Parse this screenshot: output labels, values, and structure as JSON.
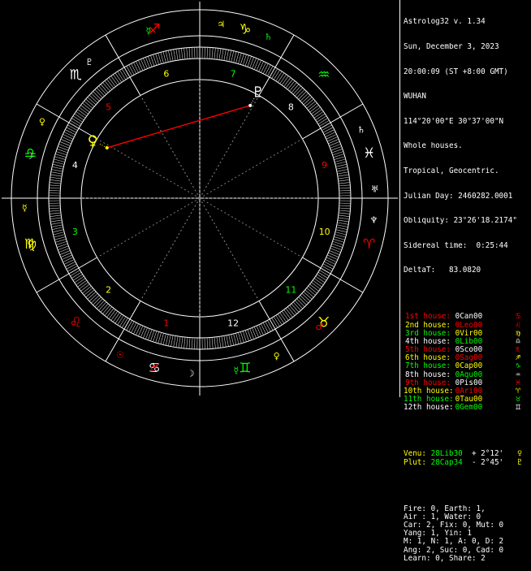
{
  "info": {
    "program": "Astrolog32 v. 1.34",
    "date": "Sun, December 3, 2023",
    "time": "20:00:09 (ST +8:00 GMT)",
    "place": "WUHAN",
    "coords": "114°20'00\"E 30°37'00\"N",
    "house_system": "Whole houses.",
    "zodiac": "Tropical, Geocentric.",
    "julian_day": "Julian Day: 2460282.0001",
    "obliquity": "Obliquity: 23°26'18.2174\"",
    "sidereal_time": "Sidereal time:  0:25:44",
    "delta_t": "DeltaT:   83.0820"
  },
  "houses": [
    {
      "name": "1st house:",
      "cusp": "0Can00",
      "glyph": "♋",
      "name_color": "#ff0000",
      "cusp_color": "#ffffff",
      "glyph_color": "#ff0000"
    },
    {
      "name": "2nd house:",
      "cusp": "0Leo00",
      "glyph": "♌",
      "name_color": "#ffff00",
      "cusp_color": "#ff0000",
      "glyph_color": "#ff0000"
    },
    {
      "name": "3rd house:",
      "cusp": "0Vir00",
      "glyph": "♍",
      "name_color": "#00ff00",
      "cusp_color": "#ffff00",
      "glyph_color": "#ffff00"
    },
    {
      "name": "4th house:",
      "cusp": "0Lib00",
      "glyph": "♎",
      "name_color": "#ffffff",
      "cusp_color": "#00ff00",
      "glyph_color": "#ffffff"
    },
    {
      "name": "5th house:",
      "cusp": "0Sco00",
      "glyph": "♏",
      "name_color": "#ff0000",
      "cusp_color": "#ffffff",
      "glyph_color": "#ff0000"
    },
    {
      "name": "6th house:",
      "cusp": "0Sag00",
      "glyph": "♐",
      "name_color": "#ffff00",
      "cusp_color": "#ff0000",
      "glyph_color": "#ffff00"
    },
    {
      "name": "7th house:",
      "cusp": "0Cap00",
      "glyph": "♑",
      "name_color": "#00ff00",
      "cusp_color": "#ffff00",
      "glyph_color": "#00ff00"
    },
    {
      "name": "8th house:",
      "cusp": "0Aqu00",
      "glyph": "♒",
      "name_color": "#ffffff",
      "cusp_color": "#00ff00",
      "glyph_color": "#ffffff"
    },
    {
      "name": "9th house:",
      "cusp": "0Pis00",
      "glyph": "♓",
      "name_color": "#ff0000",
      "cusp_color": "#ffffff",
      "glyph_color": "#ff0000"
    },
    {
      "name": "10th house:",
      "cusp": "0Ari00",
      "glyph": "♈",
      "name_color": "#ffff00",
      "cusp_color": "#ff0000",
      "glyph_color": "#ffff00"
    },
    {
      "name": "11th house:",
      "cusp": "0Tau00",
      "glyph": "♉",
      "name_color": "#00ff00",
      "cusp_color": "#ffff00",
      "glyph_color": "#00ff00"
    },
    {
      "name": "12th house:",
      "cusp": "0Gem00",
      "glyph": "♊",
      "name_color": "#ffffff",
      "cusp_color": "#00ff00",
      "glyph_color": "#ffffff"
    }
  ],
  "aspects": [
    {
      "planet": "Venu:",
      "pos": "28Lib30",
      "orb": "+ 2°12'",
      "glyph": "♀",
      "color": "#ffff00"
    },
    {
      "planet": "Plut:",
      "pos": "28Cap34",
      "orb": "- 2°45'",
      "glyph": "♇",
      "color": "#ffff00"
    }
  ],
  "stats": [
    "Fire: 0, Earth: 1,",
    "Air : 1, Water: 0",
    "Car: 2, Fix: 0, Mut: 0",
    "Yang: 1, Yin: 1",
    "M: 1, N: 1, A: 0, D: 2",
    "Ang: 2, Suc: 0, Cad: 0",
    "Learn: 0, Share: 2"
  ],
  "wheel": {
    "house_numbers": [
      {
        "label": "1",
        "lon": 15,
        "color": "#ff0000"
      },
      {
        "label": "2",
        "lon": 45,
        "color": "#ffff00"
      },
      {
        "label": "3",
        "lon": 75,
        "color": "#00ff00"
      },
      {
        "label": "4",
        "lon": 105,
        "color": "#ffffff"
      },
      {
        "label": "5",
        "lon": 135,
        "color": "#ff0000"
      },
      {
        "label": "6",
        "lon": 165,
        "color": "#ffff00"
      },
      {
        "label": "7",
        "lon": 195,
        "color": "#00ff00"
      },
      {
        "label": "8",
        "lon": 225,
        "color": "#ffffff"
      },
      {
        "label": "9",
        "lon": 255,
        "color": "#ff0000"
      },
      {
        "label": "10",
        "lon": 285,
        "color": "#ffff00"
      },
      {
        "label": "11",
        "lon": 315,
        "color": "#00ff00"
      },
      {
        "label": "12",
        "lon": 345,
        "color": "#ffffff"
      }
    ],
    "signs": [
      {
        "glyph": "♋",
        "name": "cancer",
        "lon": 15,
        "color": "#ffffff"
      },
      {
        "glyph": "♌",
        "name": "leo",
        "lon": 45,
        "color": "#ff0000"
      },
      {
        "glyph": "♍",
        "name": "virgo",
        "lon": 75,
        "color": "#ffff00"
      },
      {
        "glyph": "♎",
        "name": "libra",
        "lon": 105,
        "color": "#00ff00"
      },
      {
        "glyph": "♏",
        "name": "scorpio",
        "lon": 135,
        "color": "#ffffff"
      },
      {
        "glyph": "♐",
        "name": "sagittarius",
        "lon": 165,
        "color": "#ff0000"
      },
      {
        "glyph": "♑",
        "name": "capricorn",
        "lon": 195,
        "color": "#ffff00"
      },
      {
        "glyph": "♒",
        "name": "aquarius",
        "lon": 225,
        "color": "#00ff00"
      },
      {
        "glyph": "♓",
        "name": "pisces",
        "lon": 255,
        "color": "#ffffff"
      },
      {
        "glyph": "♈",
        "name": "aries",
        "lon": 285,
        "color": "#ff0000"
      },
      {
        "glyph": "♉",
        "name": "taurus",
        "lon": 315,
        "color": "#ffff00"
      },
      {
        "glyph": "♊",
        "name": "gemini",
        "lon": 345,
        "color": "#00ff00"
      }
    ],
    "rulers": [
      {
        "glyph": "☽",
        "name": "moon-ruler",
        "lon": 3,
        "color": "#ffffff"
      },
      {
        "glyph": "♂",
        "name": "mars-ruler",
        "lon": 15,
        "color": "#ff0000"
      },
      {
        "glyph": "☉",
        "name": "sun-ruler",
        "lon": 27,
        "color": "#ff0000"
      },
      {
        "glyph": "♀",
        "name": "venus-ruler",
        "lon": 75,
        "color": "#ffff00"
      },
      {
        "glyph": "☿",
        "name": "mercury-ruler",
        "lon": 87,
        "color": "#ffff00"
      },
      {
        "glyph": "☽",
        "name": "moon-ruler",
        "lon": 104,
        "color": "#ffffff"
      },
      {
        "glyph": "♀",
        "name": "venus-ruler",
        "lon": 116,
        "color": "#ffff00"
      },
      {
        "glyph": "♇",
        "name": "pluto-ruler",
        "lon": 141,
        "color": "#ffffff"
      },
      {
        "glyph": "☿",
        "name": "mercury-ruler",
        "lon": 163,
        "color": "#00ff00"
      },
      {
        "glyph": "♃",
        "name": "jupiter-ruler",
        "lon": 187,
        "color": "#ffff00"
      },
      {
        "glyph": "♄",
        "name": "saturn-ruler",
        "lon": 203,
        "color": "#00ff00"
      },
      {
        "glyph": "♄",
        "name": "saturn-ruler",
        "lon": 247,
        "color": "#ffffff"
      },
      {
        "glyph": "♅",
        "name": "uranus-ruler",
        "lon": 267,
        "color": "#ffffff"
      },
      {
        "glyph": "♆",
        "name": "neptune-ruler",
        "lon": 277,
        "color": "#ffffff"
      },
      {
        "glyph": "♂",
        "name": "mars-ruler",
        "lon": 317,
        "color": "#ff0000"
      },
      {
        "glyph": "♀",
        "name": "venus-ruler",
        "lon": 334,
        "color": "#ffff00"
      },
      {
        "glyph": "☿",
        "name": "mercury-ruler",
        "lon": 348,
        "color": "#00ff00"
      }
    ],
    "planets": [
      {
        "glyph": "♀",
        "name": "venus",
        "lon": 118.5,
        "color": "#ffff00"
      },
      {
        "glyph": "♇",
        "name": "pluto",
        "lon": 208.6,
        "color": "#ffffff"
      }
    ],
    "aspect_line_color": "#ff0000"
  }
}
